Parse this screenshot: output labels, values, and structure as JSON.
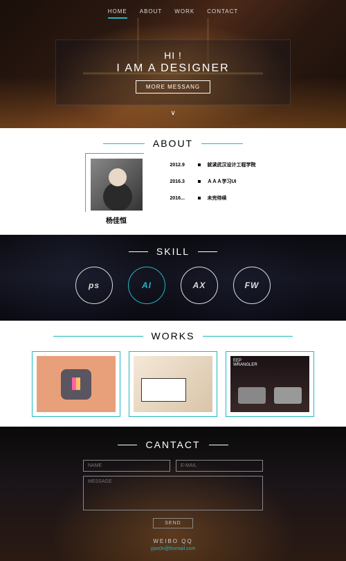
{
  "nav": {
    "home": "HOME",
    "about": "ABOUT",
    "work": "WORK",
    "contact": "CONTACT"
  },
  "hero": {
    "hi": "HI !",
    "iam": "I AM A DESIGNER",
    "more": "MORE MESSANG",
    "chev": "∨"
  },
  "about": {
    "title": "ABOUT",
    "name": "杨佳恒",
    "timeline": [
      {
        "date": "2012.9",
        "text": "就读武汉设计工程学院"
      },
      {
        "date": "2016.3",
        "text": "ＡＡＡ学习UI"
      },
      {
        "date": "2016...",
        "text": "未完待续"
      }
    ]
  },
  "skill": {
    "title": "SKILL",
    "items": [
      "ps",
      "AI",
      "AX",
      "FW"
    ]
  },
  "works": {
    "title": "WORKS",
    "w3_top": "EEP",
    "w3_sub": "WRANGLER"
  },
  "contact": {
    "title": "CANTACT",
    "name_ph": "NAME",
    "email_ph": "E-MAIL",
    "msg_ph": "MESSAGE",
    "send": "SEND"
  },
  "footer": {
    "social": "WEIBO  QQ",
    "email": "yjas0n@foxmail.com"
  }
}
